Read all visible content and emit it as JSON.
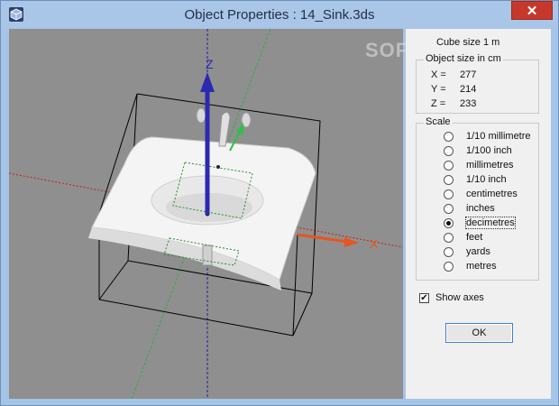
{
  "window": {
    "title": "Object Properties : 14_Sink.3ds",
    "close_label": "✕"
  },
  "panel": {
    "cube_size": "Cube size 1 m",
    "object_size": {
      "title": "Object size in cm",
      "x_label": "X =",
      "x_value": "277",
      "y_label": "Y =",
      "y_value": "214",
      "z_label": "Z =",
      "z_value": "233"
    },
    "scale": {
      "title": "Scale",
      "options": [
        "1/10 millimetre",
        "1/100 inch",
        "millimetres",
        "1/10 inch",
        "centimetres",
        "inches",
        "decimetres",
        "feet",
        "yards",
        "metres"
      ],
      "selected": "decimetres"
    },
    "show_axes_label": "Show axes",
    "show_axes_checked": true,
    "ok_label": "OK"
  },
  "viewport": {
    "axis_x_label": "X",
    "axis_z_label": "Z",
    "x_axis_color": "#e8551f",
    "z_axis_color": "#3a3ab8",
    "y_axis_color": "#3ec85a",
    "background": "#8f8f8f"
  },
  "watermark": "SOFTPEDIA"
}
